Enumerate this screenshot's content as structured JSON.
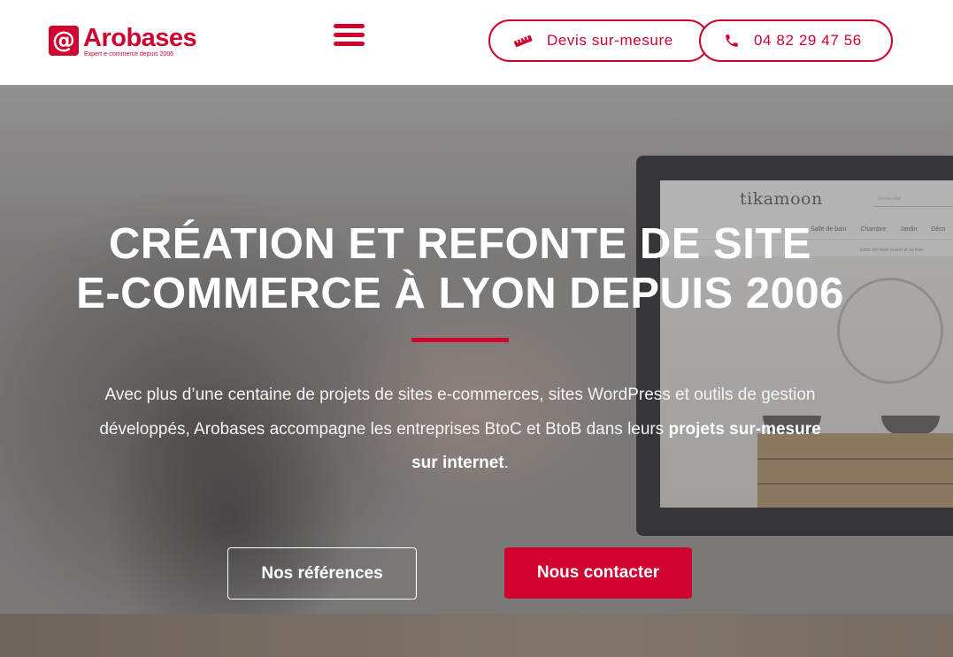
{
  "brand": {
    "logo_symbol": "@",
    "name": "Arobases",
    "tagline": "Expert e-commerce depuis 2006",
    "color": "#d0022e"
  },
  "header": {
    "menu_icon": "hamburger-menu-icon",
    "quote_button": {
      "label": "Devis sur-mesure",
      "icon": "ruler-pencil-icon"
    },
    "phone_button": {
      "label": "04 82 29 47 56",
      "icon": "phone-icon"
    }
  },
  "hero": {
    "title_line1": "CRÉATION ET REFONTE DE SITE",
    "title_line2": "E-COMMERCE À LYON DEPUIS 2006",
    "intro_text": "Avec plus d’une centaine de projets de sites e-commerces, sites WordPress et outils de gestion développés, Arobases accompagne les entreprises BtoC et BtoB dans leurs ",
    "intro_bold": "projets sur-mesure sur internet",
    "intro_end": ".",
    "references_button": "Nos références",
    "contact_button": "Nous contacter"
  },
  "background_screen": {
    "site_name": "tikamoon",
    "search_placeholder": "Rechercher",
    "nav_items": [
      "Salle de bain",
      "Chambre",
      "Jardin",
      "Déco"
    ],
    "info_text": "Entre été reste ouvert et au frais"
  }
}
